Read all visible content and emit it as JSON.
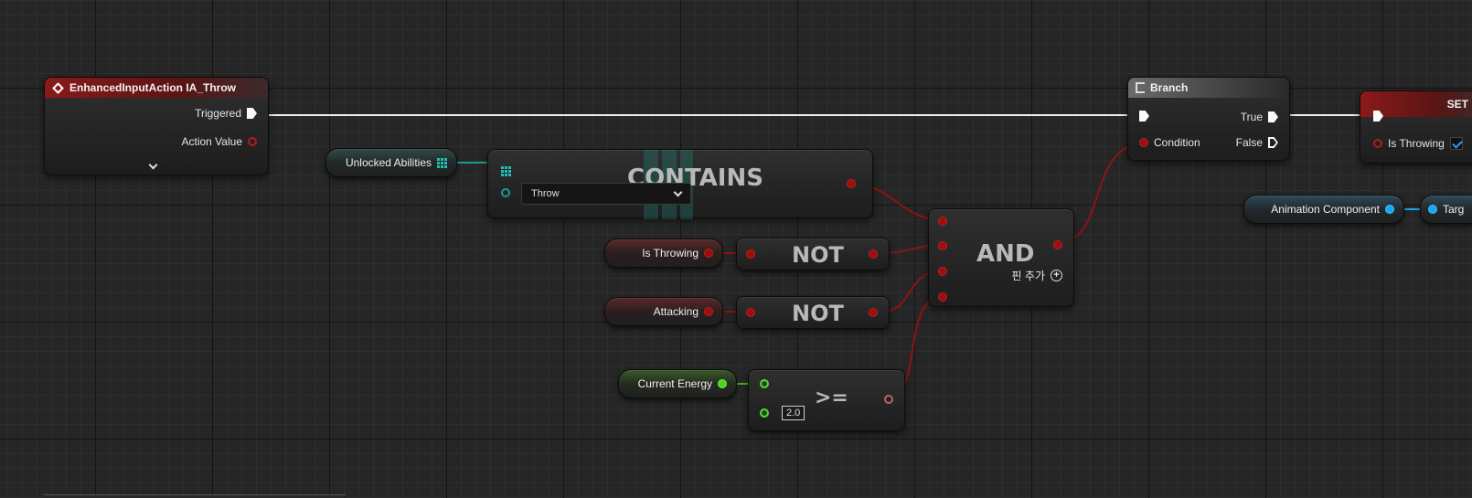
{
  "nodes": {
    "input_action": {
      "title": "EnhancedInputAction IA_Throw",
      "triggered": "Triggered",
      "action_value": "Action Value"
    },
    "unlocked_abilities": {
      "label": "Unlocked Abilities"
    },
    "contains": {
      "title": "CONTAINS",
      "dropdown_value": "Throw"
    },
    "is_throwing": {
      "label": "Is Throwing"
    },
    "attacking": {
      "label": "Attacking"
    },
    "not1": {
      "title": "NOT"
    },
    "not2": {
      "title": "NOT"
    },
    "and": {
      "title": "AND",
      "add_pin": "핀 추가"
    },
    "current_energy": {
      "label": "Current Energy"
    },
    "compare": {
      "title": ">=",
      "value": "2.0"
    },
    "branch": {
      "title": "Branch",
      "condition": "Condition",
      "true_label": "True",
      "false_label": "False"
    },
    "set": {
      "title": "SET",
      "is_throwing": "Is Throwing"
    },
    "animation_component": {
      "label": "Animation Component"
    },
    "target": {
      "label": "Targ"
    }
  },
  "colors": {
    "exec": "#fafafa",
    "boolean": "#9a0f0f",
    "float": "#4cd41f",
    "object": "#17a9f0",
    "enum": "#1a9c94"
  },
  "icons": [
    "diamond-event-icon",
    "branch-icon",
    "chevron-down-icon",
    "array-grid-icon",
    "plus-circle-icon",
    "checkbox-checked-icon"
  ]
}
